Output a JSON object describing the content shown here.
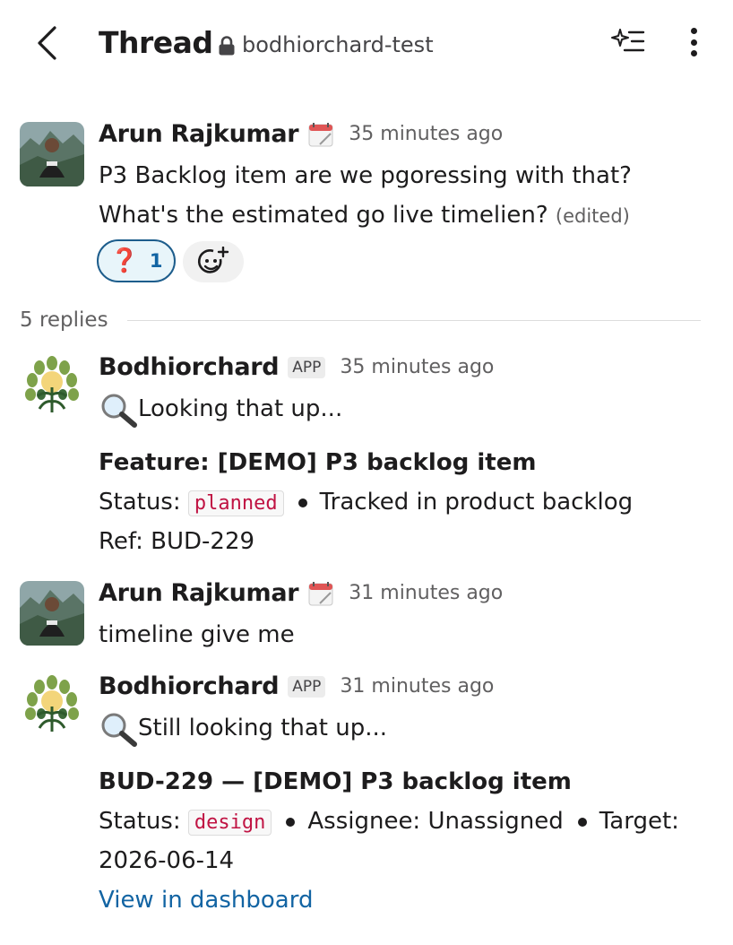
{
  "header": {
    "title": "Thread",
    "channel": "bodhiorchard-test"
  },
  "parent": {
    "author": "Arun Rajkumar",
    "time": "35 minutes ago",
    "line1": "P3 Backlog item are we pgoressing with that?",
    "line2": "What's the estimated go live timelien?",
    "edited": "(edited)",
    "reaction": {
      "emoji": "❓",
      "count": "1"
    }
  },
  "replies_label": "5 replies",
  "replies": [
    {
      "author": "Bodhiorchard",
      "badge": "APP",
      "time": "35 minutes ago",
      "lookup": "Looking that up...",
      "heading": "Feature: [DEMO] P3 backlog item",
      "status_label": "Status:",
      "status": "planned",
      "tracked": "Tracked in product backlog",
      "ref": "Ref: BUD-229"
    },
    {
      "author": "Arun Rajkumar",
      "time": "31 minutes ago",
      "text": "timeline give me"
    },
    {
      "author": "Bodhiorchard",
      "badge": "APP",
      "time": "31 minutes ago",
      "lookup": "Still looking that up...",
      "heading": "BUD-229 — [DEMO] P3 backlog item",
      "status_label": "Status:",
      "status": "design",
      "assignee": "Assignee: Unassigned",
      "target_label": "Target:",
      "target_date": "2026-06-14",
      "link": "View in dashboard"
    }
  ],
  "colors": {
    "link": "#1264a3",
    "code_text": "#c01343",
    "reaction_border": "#1d5d8c",
    "reaction_bg": "#e8f5fa"
  }
}
